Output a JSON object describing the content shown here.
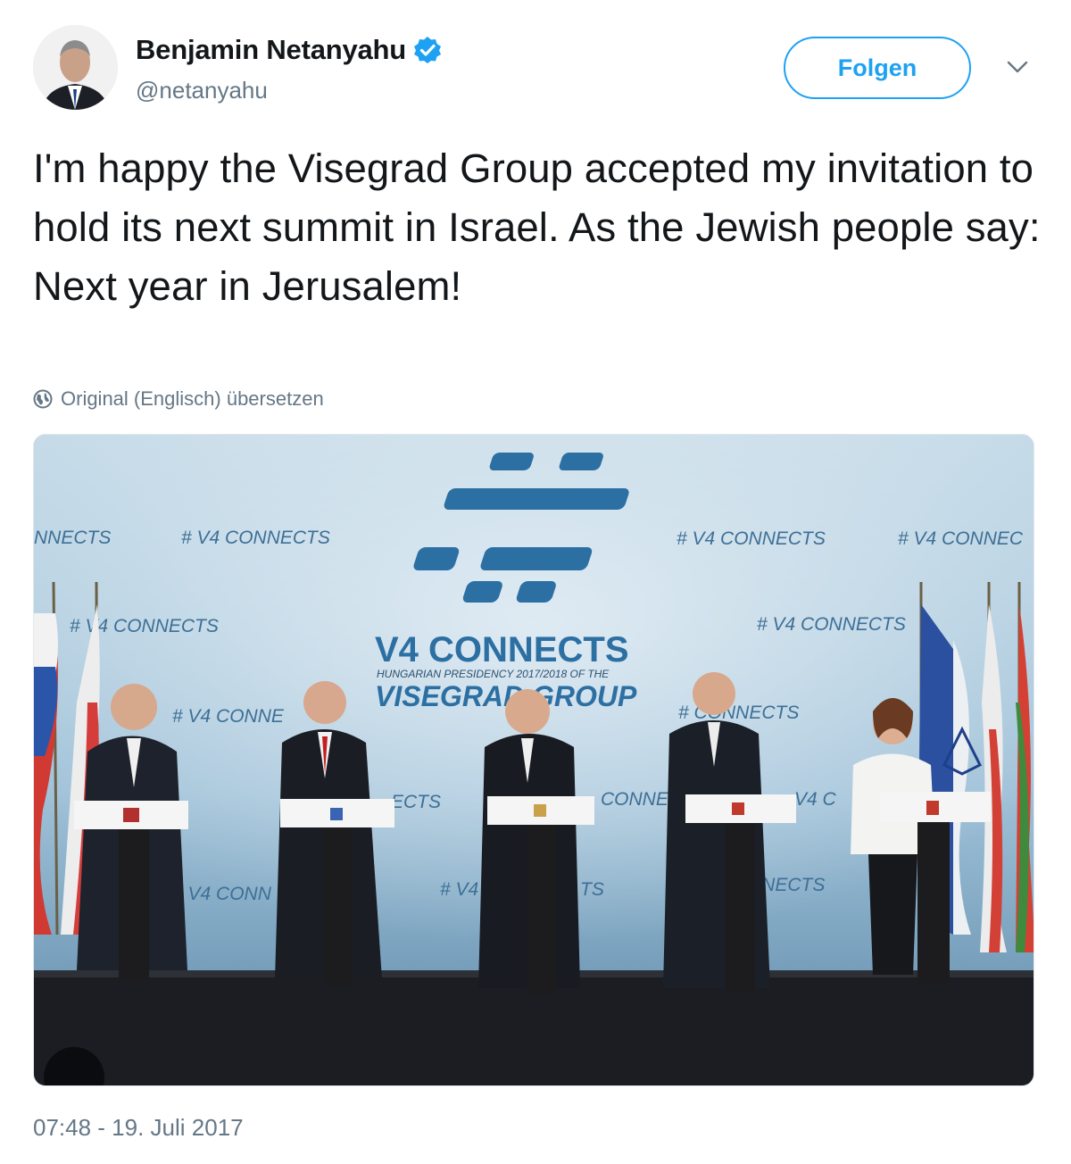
{
  "author": {
    "display_name": "Benjamin Netanyahu",
    "handle": "@netanyahu",
    "verified": true,
    "avatar_icon": "profile-photo"
  },
  "actions": {
    "follow_label": "Folgen",
    "more_icon": "chevron-down-icon"
  },
  "tweet": {
    "text": "I'm happy the Visegrad Group accepted my invitation to hold its next summit in Israel. As the Jewish people say: Next year in Jerusalem!",
    "translate_label": "Original (Englisch) übersetzen",
    "translate_icon": "globe-icon",
    "timestamp": "07:48 - 19. Juli 2017"
  },
  "media": {
    "backdrop": {
      "main_title": "V4 CONNECTS",
      "subtitle": "HUNGARIAN PRESIDENCY 2017/2018 OF THE",
      "group_title": "VISEGRAD GROUP",
      "tags": [
        "NNECTS",
        "# V4 CONNECTS",
        "# V4 CONNECTS",
        "# V4 CONNEC",
        "# V4 CONNECTS",
        "# V4 CONNECTS",
        "# V4 CONNE",
        "# CONNECTS",
        "ECTS",
        "CONNE",
        "V4 C",
        "# V4 CONN",
        "# V4",
        "TS",
        "NNECTS"
      ]
    }
  },
  "colors": {
    "accent": "#1da1f2",
    "text": "#14171a",
    "secondary": "#657786",
    "border": "#e1e8ed",
    "backdrop": "#a9c9dd",
    "backdrop_dark": "#2c6fa3"
  }
}
